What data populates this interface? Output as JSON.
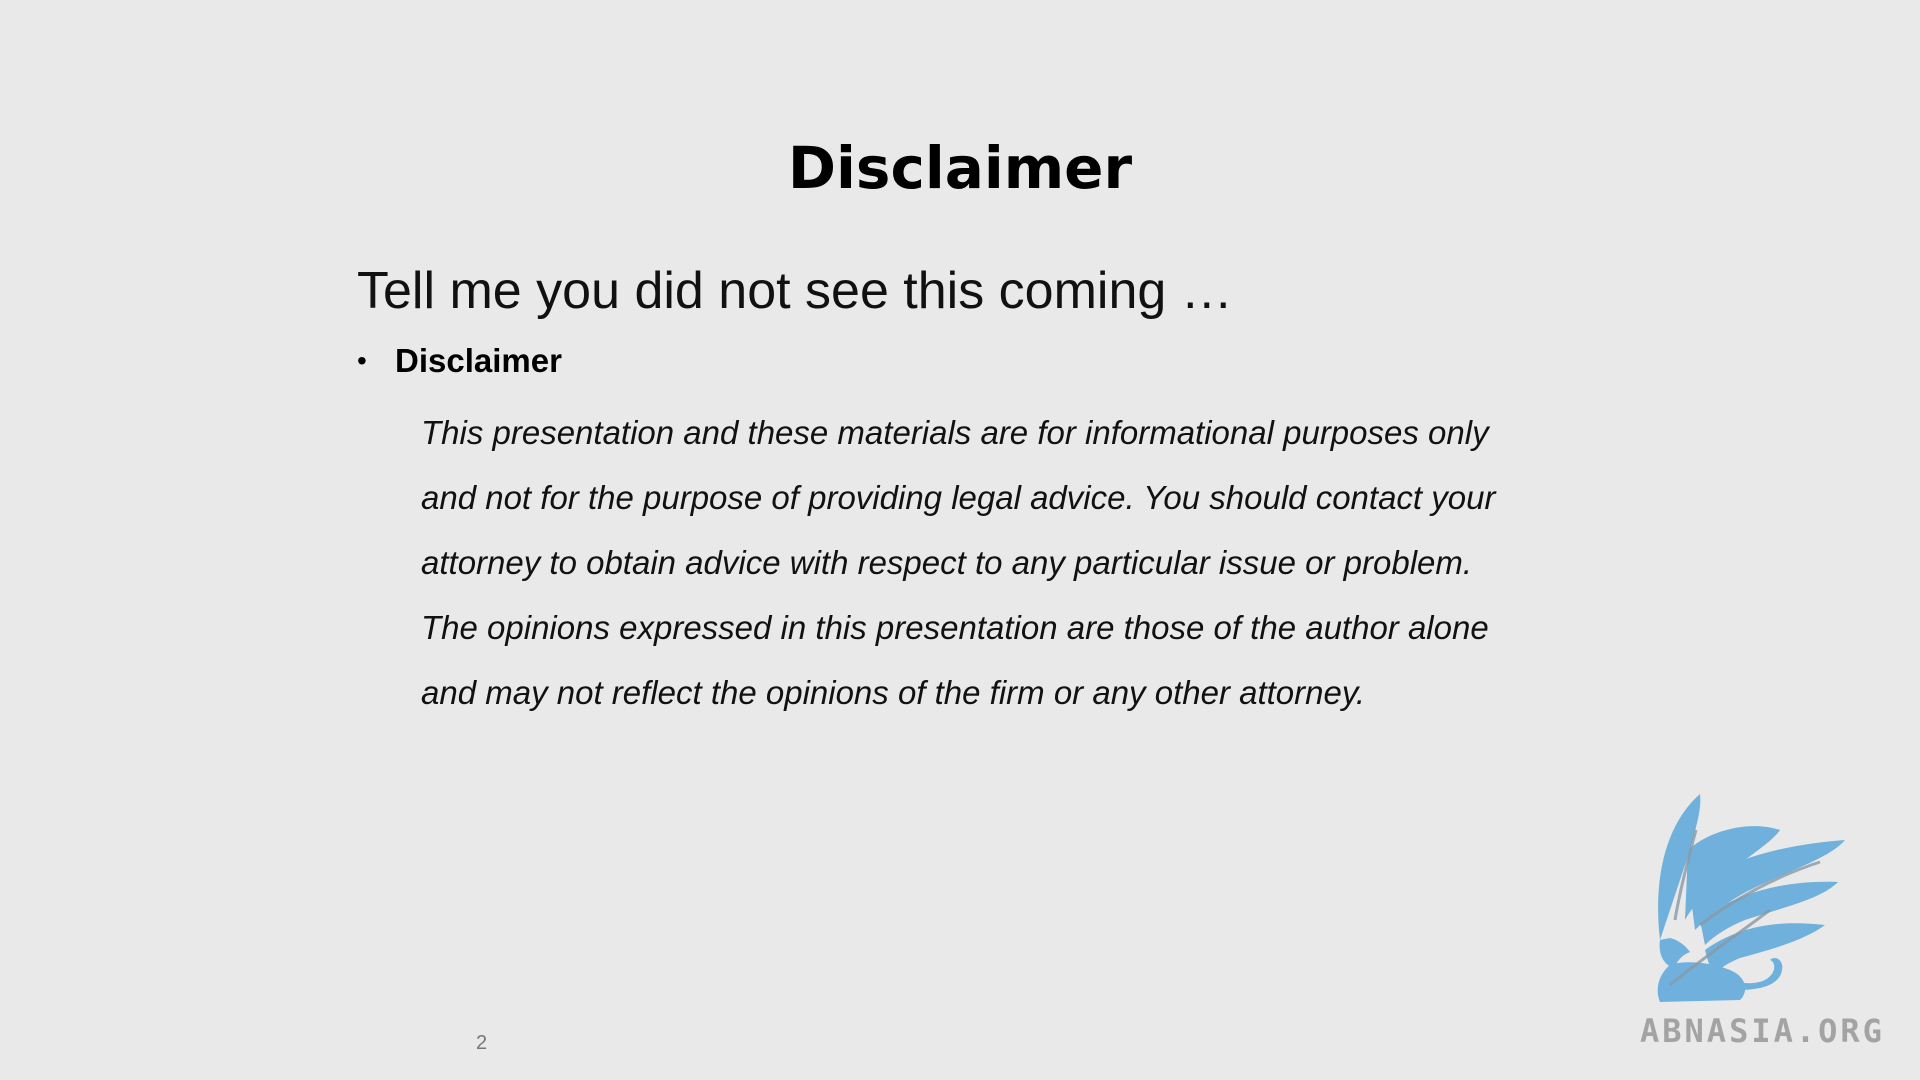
{
  "slide": {
    "title": "Disclaimer",
    "subtitle": "Tell me you did not see this coming …",
    "bullet": {
      "marker": "•",
      "label": "Disclaimer"
    },
    "body_lines": [
      "This presentation and these materials are for informational purposes only",
      "and not for the purpose of providing legal advice. You should contact your",
      "attorney to obtain advice with respect to any particular issue or problem.",
      "The opinions expressed in this presentation are those of the author alone",
      "and may not reflect the opinions of the firm or any other attorney."
    ],
    "page_number": "2"
  },
  "watermark": {
    "text": "ABNASIA.ORG",
    "icon": "griffin-logo-icon",
    "color": "#6fb0dc"
  },
  "colors": {
    "background": "#e9e9e9",
    "text": "#000000"
  }
}
